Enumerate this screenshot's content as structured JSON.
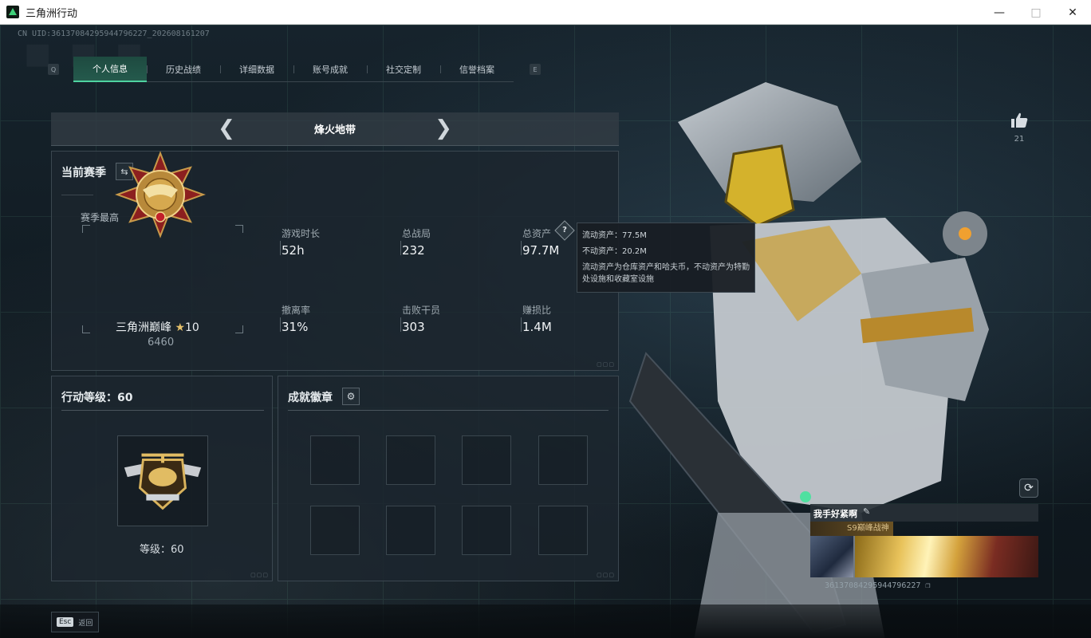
{
  "window": {
    "title": "三角洲行动"
  },
  "uid_top": "CN UID:36137084295944796227_202608161207",
  "tabs": {
    "left_key": "Q",
    "right_key": "E",
    "items": [
      {
        "label": "个人信息",
        "active": true
      },
      {
        "label": "历史战绩",
        "active": false
      },
      {
        "label": "详细数据",
        "active": false
      },
      {
        "label": "账号成就",
        "active": false
      },
      {
        "label": "社交定制",
        "active": false
      },
      {
        "label": "信誉档案",
        "active": false
      }
    ]
  },
  "mode": {
    "label": "烽火地带"
  },
  "season": {
    "title": "当前赛季",
    "best_label": "赛季最高",
    "rank_name": "三角洲巅峰",
    "rank_star_level": "10",
    "rank_score": "6460",
    "stats": [
      {
        "label": "游戏时长",
        "value": "52h"
      },
      {
        "label": "总战局",
        "value": "232"
      },
      {
        "label": "总资产",
        "value": "97.7M"
      },
      {
        "label": "撤离率",
        "value": "31%"
      },
      {
        "label": "击败干员",
        "value": "303"
      },
      {
        "label": "赚损比",
        "value": "1.4M"
      }
    ],
    "help_glyph": "?"
  },
  "tooltip": {
    "liquid": "流动资产：77.5M",
    "fixed": "不动资产：20.2M",
    "description": "流动资产为仓库资产和哈夫币，不动资产为特勤处设施和收藏室设施"
  },
  "level": {
    "title": "行动等级：60",
    "text": "等级：60"
  },
  "achievements": {
    "title": "成就徽章",
    "slot_count": 8
  },
  "like": {
    "count": "21"
  },
  "name_card": {
    "name": "我手好紧啊",
    "title_text": "S9巅峰战神"
  },
  "uid_bottom": "36137084295944796227",
  "esc": {
    "key": "Esc",
    "label": "返回"
  },
  "colors": {
    "accent": "#4fd3a0",
    "gold": "#e4c06a"
  }
}
